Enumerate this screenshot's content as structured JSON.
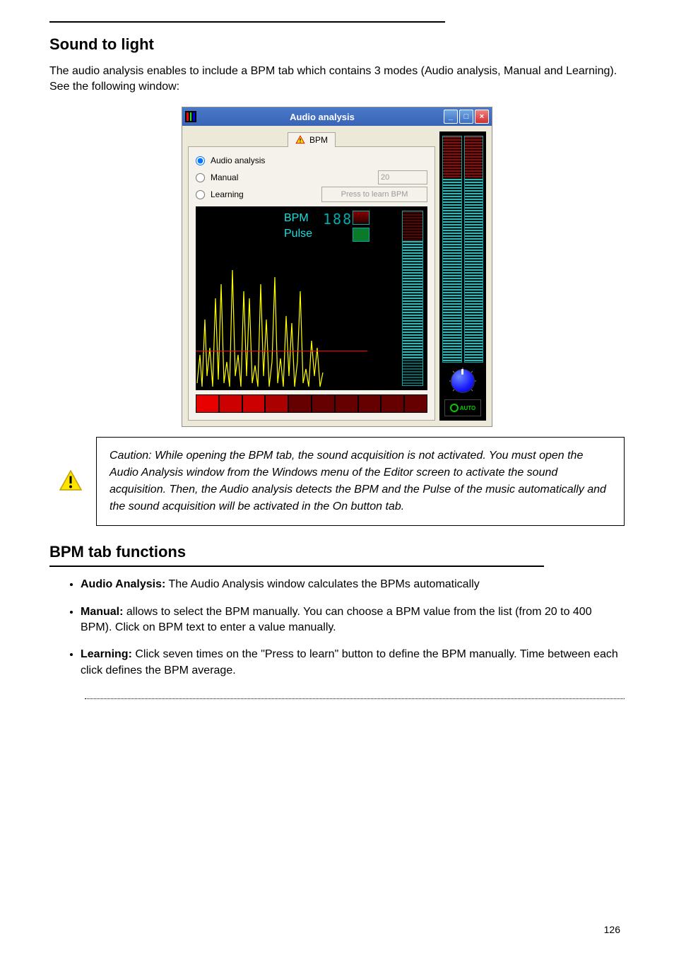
{
  "section_title": "Sound to light",
  "intro_para": "The audio analysis enables to include a BPM tab which contains 3 modes (Audio analysis, Manual and Learning). See the following window:",
  "window": {
    "title": "Audio analysis",
    "minimize": "_",
    "maximize": "□",
    "close": "×",
    "tab_label": "BPM",
    "radio_audio": "Audio analysis",
    "radio_manual": "Manual",
    "radio_learning": "Learning",
    "manual_value": "20",
    "learn_button": "Press to learn BPM",
    "bpm_label": "BPM",
    "bpm_value": "188",
    "pulse_label": "Pulse",
    "auto_label": "AUTO"
  },
  "caution": "Caution: While opening the BPM tab, the sound acquisition is not activated. You must open the Audio Analysis window from the Windows menu of the Editor screen to activate the sound acquisition. Then, the Audio analysis detects the BPM and the Pulse of the music automatically and the sound acquisition will be activated in the On button tab.",
  "sub_heading": "BPM tab functions",
  "bullets": [
    {
      "b": "Audio Analysis:",
      "t": " The Audio Analysis window calculates the BPMs automatically"
    },
    {
      "b": "Manual:",
      "t": " allows to select the BPM manually. You can choose a BPM value from the list (from 20 to 400 BPM). Click on BPM text to enter a value manually."
    },
    {
      "b": "Learning:",
      "t": " Click seven times on the \"Press to learn\" button to define the BPM manually. Time between each click defines the BPM average."
    }
  ],
  "page_number": "126"
}
